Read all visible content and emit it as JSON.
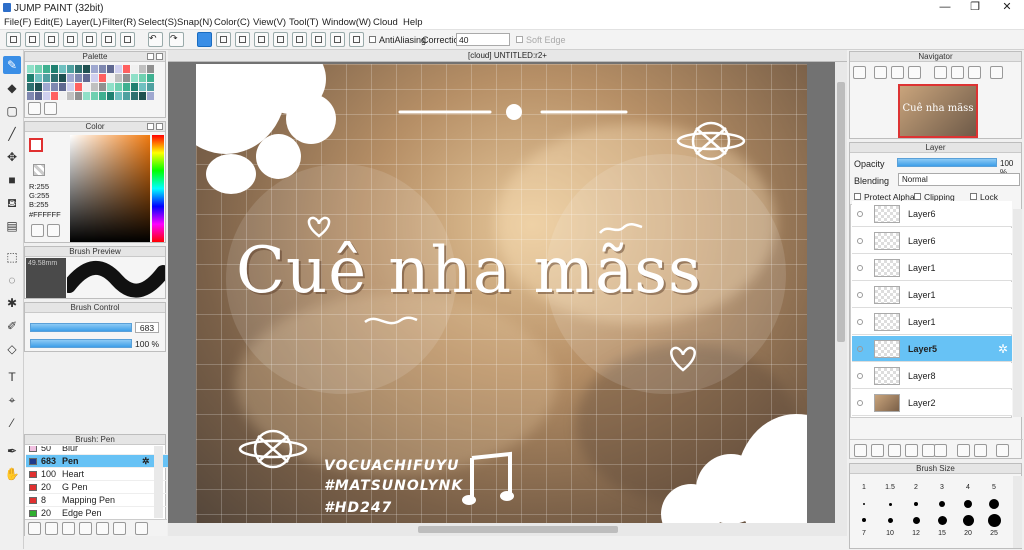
{
  "title": "JUMP PAINT (32bit)",
  "menu": [
    "File(F)",
    "Edit(E)",
    "Layer(L)",
    "Filter(R)",
    "Select(S)",
    "Snap(N)",
    "Color(C)",
    "View(V)",
    "Tool(T)",
    "Window(W)",
    "Cloud",
    "Help"
  ],
  "toolbar": {
    "antialias": "AntiAliasing",
    "correction_label": "Correction",
    "correction": "40",
    "soft_edge": "Soft Edge"
  },
  "palette": {
    "title": "Palette"
  },
  "color": {
    "title": "Color",
    "r": "R:255",
    "g": "G:255",
    "b": "B:255",
    "hex": "#FFFFFF"
  },
  "brush_preview": {
    "title": "Brush Preview",
    "size": "49.58mm"
  },
  "brush_control": {
    "title": "Brush Control",
    "size": "683",
    "opacity": "100 %"
  },
  "brush_list": {
    "title": "Brush: Pen",
    "items": [
      {
        "size": "50",
        "name": "Blur",
        "color": "#f0c0e0"
      },
      {
        "size": "683",
        "name": "Pen",
        "color": "#1e3a8a",
        "selected": true
      },
      {
        "size": "100",
        "name": "Heart",
        "color": "#e03030"
      },
      {
        "size": "20",
        "name": "G Pen",
        "color": "#e03030"
      },
      {
        "size": "8",
        "name": "Mapping Pen",
        "color": "#e03030"
      },
      {
        "size": "20",
        "name": "Edge Pen",
        "color": "#30b030"
      }
    ]
  },
  "canvas": {
    "tab": "[cloud] UNTITLED:r2+",
    "text": "Cuê nha mãss",
    "credits": [
      "VOCUACHIFUYU",
      "#MATSUNOLYNK",
      "#HD247"
    ]
  },
  "navigator": {
    "title": "Navigator",
    "thumb_text": "Cuê nha mãss"
  },
  "layer_panel": {
    "title": "Layer",
    "opacity_label": "Opacity",
    "opacity": "100 %",
    "blending_label": "Blending",
    "blending": "Normal",
    "protect_alpha": "Protect Alpha",
    "clipping": "Clipping",
    "lock": "Lock",
    "layers": [
      {
        "name": "Layer6"
      },
      {
        "name": "Layer6"
      },
      {
        "name": "Layer1"
      },
      {
        "name": "Layer1"
      },
      {
        "name": "Layer1"
      },
      {
        "name": "Layer5",
        "selected": true
      },
      {
        "name": "Layer8"
      },
      {
        "name": "Layer2",
        "image": true
      }
    ]
  },
  "brush_size": {
    "title": "Brush Size",
    "row1": [
      "1",
      "1.5",
      "2",
      "3",
      "4",
      "5"
    ],
    "row2": [
      "7",
      "10",
      "12",
      "15",
      "20",
      "25"
    ]
  }
}
